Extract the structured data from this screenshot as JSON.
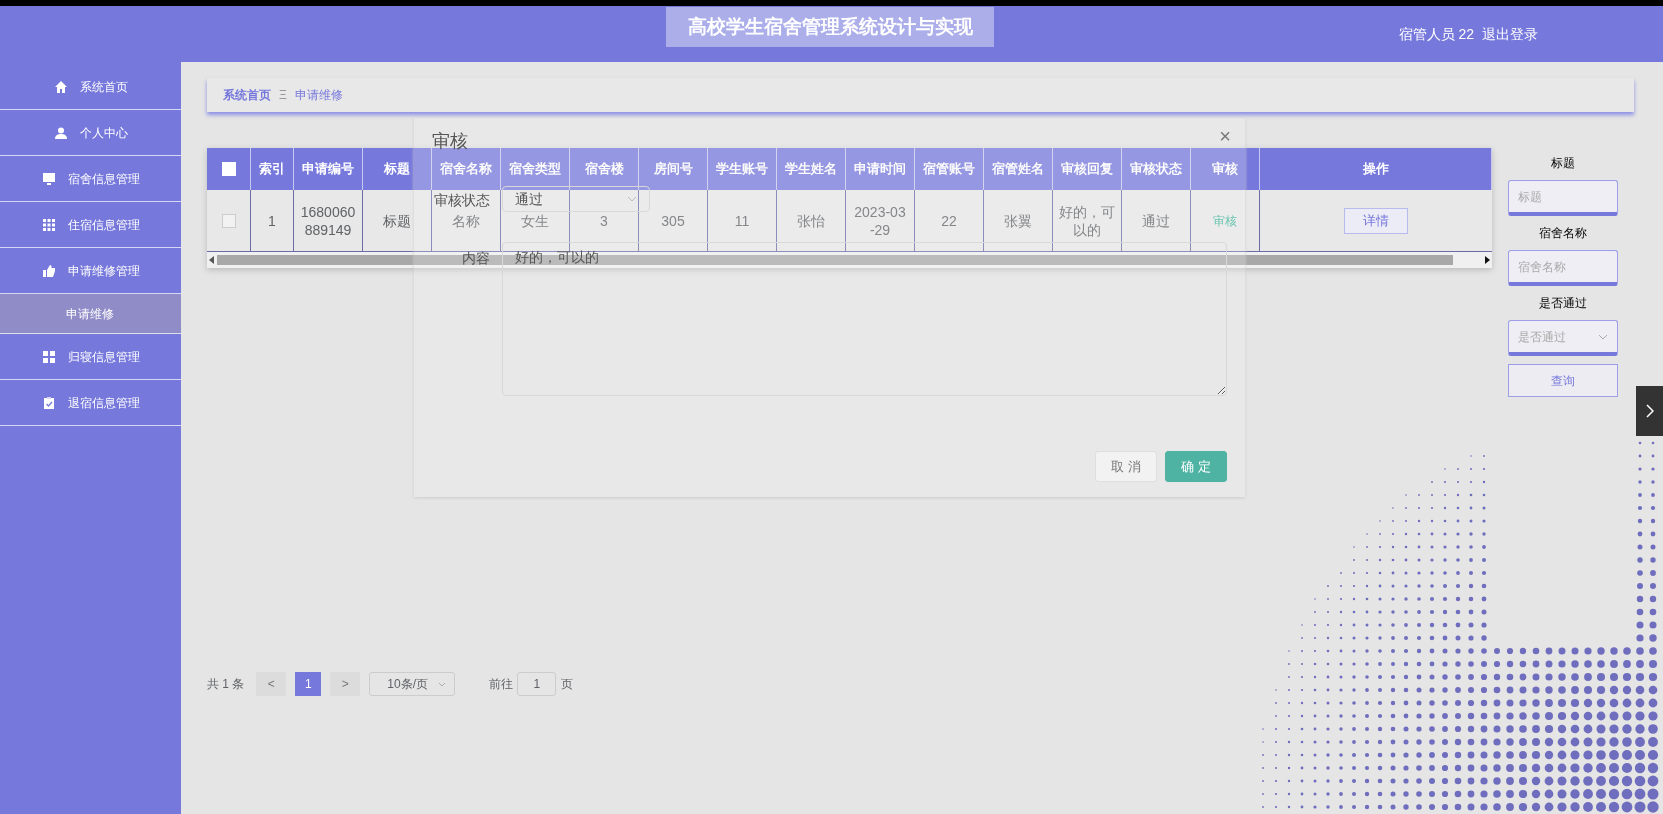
{
  "header": {
    "title": "高校学生宿舍管理系统设计与实现",
    "user": "宿管人员 22",
    "logout": "退出登录"
  },
  "sidebar": {
    "items": [
      {
        "label": "系统首页",
        "selected": false
      },
      {
        "label": "个人中心",
        "selected": false
      },
      {
        "label": "宿舍信息管理",
        "selected": false
      },
      {
        "label": "住宿信息管理",
        "selected": false
      },
      {
        "label": "申请维修管理",
        "selected": false,
        "children": [
          {
            "label": "申请维修",
            "selected": true
          }
        ]
      },
      {
        "label": "归寝信息管理",
        "selected": false
      },
      {
        "label": "退宿信息管理",
        "selected": false
      }
    ]
  },
  "breadcrumb": {
    "items": [
      "系统首页",
      "申请维修"
    ],
    "separator": "Ξ"
  },
  "table": {
    "header_checked": false,
    "columns": [
      "索引",
      "申请编号",
      "标题",
      "宿舍名称",
      "宿舍类型",
      "宿舍楼",
      "房间号",
      "学生账号",
      "学生姓名",
      "申请时间",
      "宿管账号",
      "宿管姓名",
      "审核回复",
      "审核状态",
      "审核",
      "操作"
    ],
    "rows": [
      {
        "checked": false,
        "cells": [
          "1",
          "1680060889149",
          "标题",
          "名称",
          "女生",
          "3",
          "305",
          "11",
          "张怡",
          "2023-03-29",
          "22",
          "张翼",
          "好的，可以的",
          "通过"
        ],
        "review_link": "审核",
        "detail_button": "详情"
      }
    ]
  },
  "search": {
    "fields": [
      {
        "label": "标题",
        "placeholder": "标题",
        "kind": "input"
      },
      {
        "label": "宿舍名称",
        "placeholder": "宿舍名称",
        "kind": "input"
      },
      {
        "label": "是否通过",
        "placeholder": "是否通过",
        "kind": "select"
      }
    ],
    "button": "查询"
  },
  "pagination": {
    "total": "共 1 条",
    "prev": "<",
    "pages": [
      {
        "label": "1",
        "selected": true
      }
    ],
    "next": ">",
    "page_size": "10条/页",
    "goto_label": "前往",
    "goto_value": "1",
    "goto_suffix": "页"
  },
  "dialog": {
    "title": "审核",
    "close": "×",
    "fields": [
      {
        "label": "审核状态",
        "kind": "select",
        "value": "通过"
      },
      {
        "label": "内容",
        "kind": "textarea",
        "value": "好的，可以的"
      }
    ],
    "buttons": [
      {
        "label": "取 消",
        "kind": "default"
      },
      {
        "label": "确 定",
        "kind": "primary"
      }
    ]
  }
}
